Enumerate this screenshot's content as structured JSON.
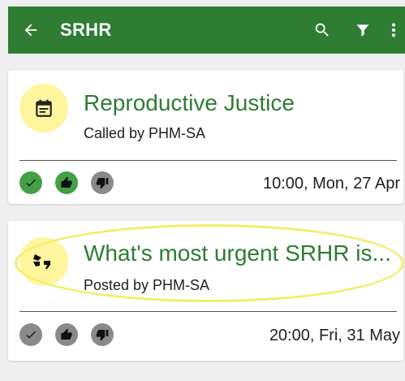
{
  "appbar": {
    "title": "SRHR",
    "color": "#2e7d32",
    "icons": [
      "arrow-back-icon",
      "search-icon",
      "filter-icon",
      "more-vert-icon"
    ]
  },
  "cards": [
    {
      "icon": "calendar-icon",
      "title": "Reproductive Justice",
      "subtitle": "Called by PHM-SA",
      "timestamp": "10:00, Mon, 27 Apr",
      "actions": [
        "check-icon",
        "thumbs-up-icon",
        "thumbs-down-icon"
      ],
      "action_state": "green-green-grey"
    },
    {
      "icon": "quote-icon",
      "title": "What's most urgent SRHR is...",
      "subtitle": "Posted by PHM-SA",
      "timestamp": "20:00, Fri, 31 May",
      "actions": [
        "check-icon",
        "thumbs-up-icon",
        "thumbs-down-icon"
      ],
      "action_state": "grey-grey-grey"
    }
  ],
  "colors": {
    "accent_green": "#2e7d32",
    "action_green": "#43a047",
    "avatar_yellow": "#fff59d",
    "highlight_yellow": "#f2ee6a"
  }
}
